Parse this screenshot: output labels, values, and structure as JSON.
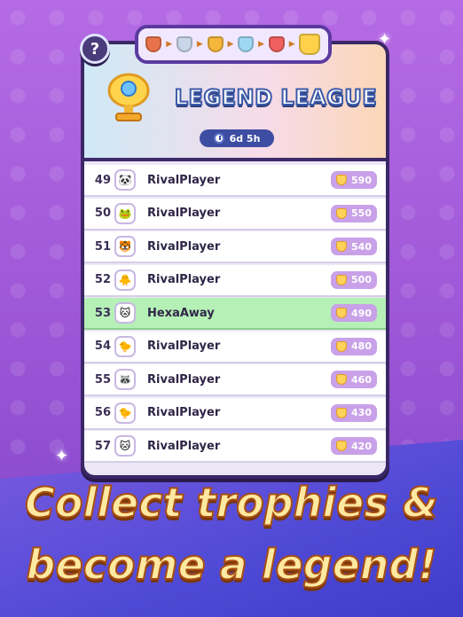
{
  "league": {
    "title": "LEGEND LEAGUE",
    "timer": "6d 5h"
  },
  "help_label": "?",
  "leaderboard": [
    {
      "rank": "49",
      "name": "RivalPlayer",
      "score": "590",
      "avatar": "panda-icon",
      "highlight": false
    },
    {
      "rank": "50",
      "name": "RivalPlayer",
      "score": "550",
      "avatar": "frog-icon",
      "highlight": false
    },
    {
      "rank": "51",
      "name": "RivalPlayer",
      "score": "540",
      "avatar": "tiger-icon",
      "highlight": false
    },
    {
      "rank": "52",
      "name": "RivalPlayer",
      "score": "500",
      "avatar": "duck-icon",
      "highlight": false
    },
    {
      "rank": "53",
      "name": "HexaAway",
      "score": "490",
      "avatar": "cat-icon",
      "highlight": true
    },
    {
      "rank": "54",
      "name": "RivalPlayer",
      "score": "480",
      "avatar": "chick-icon",
      "highlight": false
    },
    {
      "rank": "55",
      "name": "RivalPlayer",
      "score": "460",
      "avatar": "raccoon-icon",
      "highlight": false
    },
    {
      "rank": "56",
      "name": "RivalPlayer",
      "score": "430",
      "avatar": "chick-icon",
      "highlight": false
    },
    {
      "rank": "57",
      "name": "RivalPlayer",
      "score": "420",
      "avatar": "cat-icon",
      "highlight": false
    }
  ],
  "promo": {
    "line1": "Collect trophies &",
    "line2": "become a legend!"
  },
  "colors": {
    "background": "#a45ad8",
    "highlight_row": "#b5f0b6",
    "score_badge": "#c9a1e8",
    "title_stroke": "#3c5aa8"
  }
}
